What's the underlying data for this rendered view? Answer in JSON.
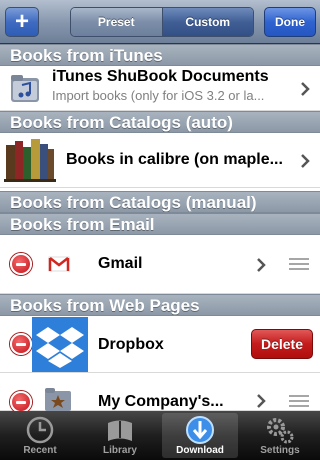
{
  "navbar": {
    "add_label": "+",
    "segments": [
      "Preset",
      "Custom"
    ],
    "done_label": "Done"
  },
  "sections": [
    "Books from iTunes",
    "Books from Catalogs (auto)",
    "Books from Catalogs (manual)",
    "Books from Email",
    "Books from Web Pages"
  ],
  "rows": {
    "itunes": {
      "title": "iTunes ShuBook Documents",
      "subtitle": "Import books (only for iOS 3.2 or la..."
    },
    "calibre": {
      "title": "Books in calibre (on maple..."
    },
    "gmail": {
      "title": "Gmail"
    },
    "dropbox": {
      "title": "Dropbox",
      "delete_label": "Delete"
    },
    "company": {
      "title": "My Company's..."
    }
  },
  "tabs": [
    {
      "label": "Recent",
      "icon": "clock-icon"
    },
    {
      "label": "Library",
      "icon": "book-icon"
    },
    {
      "label": "Download",
      "icon": "download-arrow-icon"
    },
    {
      "label": "Settings",
      "icon": "gears-icon"
    }
  ],
  "colors": {
    "nav_gradient_top": "#b3bfcf",
    "section_gradient": "#8c98a6",
    "done_blue": "#2f63d0",
    "delete_red": "#c41b1b",
    "dropbox_blue": "#2d7fd9"
  }
}
